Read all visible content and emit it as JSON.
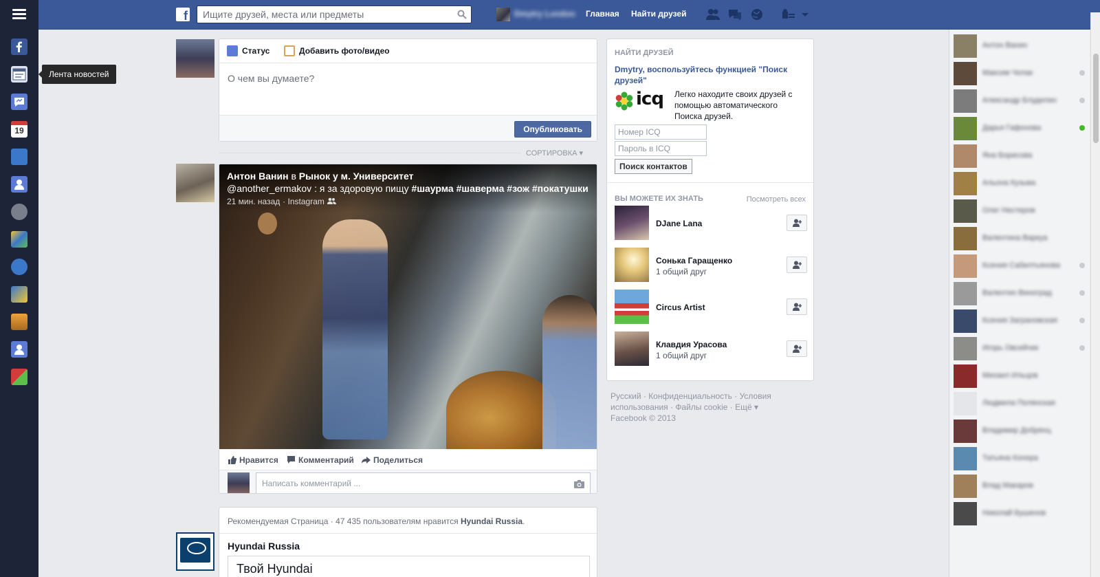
{
  "search": {
    "placeholder": "Ищите друзей, места или предметы"
  },
  "topnav": {
    "user_name": "Dmytry London",
    "home": "Главная",
    "find_friends": "Найти друзей"
  },
  "leftnav": {
    "tooltip": "Лента новостей",
    "calendar_day": "19",
    "icons": [
      "facebook-icon",
      "news-feed-icon",
      "messages-icon",
      "events-icon",
      "app-icon",
      "friends-icon",
      "pages-icon",
      "games-icon",
      "app-icon-2",
      "app-icon-3",
      "photos-icon",
      "groups-icon",
      "apps-icon"
    ]
  },
  "composer": {
    "tab_status": "Статус",
    "tab_photo": "Добавить фото/видео",
    "placeholder": "О чем вы думаете?",
    "post_button": "Опубликовать"
  },
  "feed": {
    "sort_label": "СОРТИРОВКА"
  },
  "post": {
    "author": "Антон Ванин",
    "in_word": "в",
    "place": "Рынок у м. Университет",
    "text_handle": "@another_ermakov",
    "text_body": ": я за здоровую пищу",
    "tags": [
      "#шаурма",
      "#шаверма",
      "#зож",
      "#покатушки"
    ],
    "time": "21 мин. назад",
    "via": "Instagram",
    "like": "Нравится",
    "comment": "Комментарий",
    "share": "Поделиться",
    "comment_placeholder": "Написать комментарий ..."
  },
  "sponsored": {
    "type": "Рекомендуемая Страница",
    "likes_text": "47 435 пользователям нравится",
    "page": "Hyundai Russia",
    "page_title": "Hyundai Russia",
    "box_title": "Твой Hyundai"
  },
  "find_friends": {
    "heading": "НАЙТИ ДРУЗЕЙ",
    "link": "Dmytry, воспользуйтесь функцией \"Поиск друзей\"",
    "icq_logo": "icq",
    "icq_desc": "Легко находите своих друзей с помощью автоматического Поиска друзей.",
    "field_number": "Номер ICQ",
    "field_password": "Пароль в ICQ",
    "search_button": "Поиск контактов"
  },
  "pymk": {
    "heading": "ВЫ МОЖЕТЕ ИХ ЗНАТЬ",
    "see_all": "Посмотреть всех",
    "people": [
      {
        "name": "DJane Lana",
        "mutual": ""
      },
      {
        "name": "Сонька Гаращенко",
        "mutual": "1 общий друг"
      },
      {
        "name": "Circus Artist",
        "mutual": ""
      },
      {
        "name": "Клавдия Урасова",
        "mutual": "1 общий друг"
      }
    ]
  },
  "footer": {
    "line1": "Русский · Конфиденциальность · Условия",
    "line2": "использования · Файлы cookie · Ещё ▾",
    "line3": "Facebook © 2013"
  },
  "chat": {
    "contacts": [
      "Антон Ванин",
      "Максим Чолак",
      "Александр Блудилин",
      "Дарья Гафонова",
      "Яна Борисова",
      "Альона Кузьма",
      "Олег Нестеров",
      "Валентина Варкуа",
      "Ксения Сабилтьянова",
      "Валентин Виноград",
      "Ксения Заграновская",
      "Игорь Овсейчик",
      "Михаил Ильцов",
      "Людмила Полянская",
      "Владимир Добрянц",
      "Татьяна Конора",
      "Влад Макаров",
      "Николай Бушенов"
    ]
  },
  "colors": {
    "brand": "#3b5998",
    "leftnav_bg": "#1e2437",
    "page_bg": "#e9eaed",
    "online": "#42b72a"
  }
}
